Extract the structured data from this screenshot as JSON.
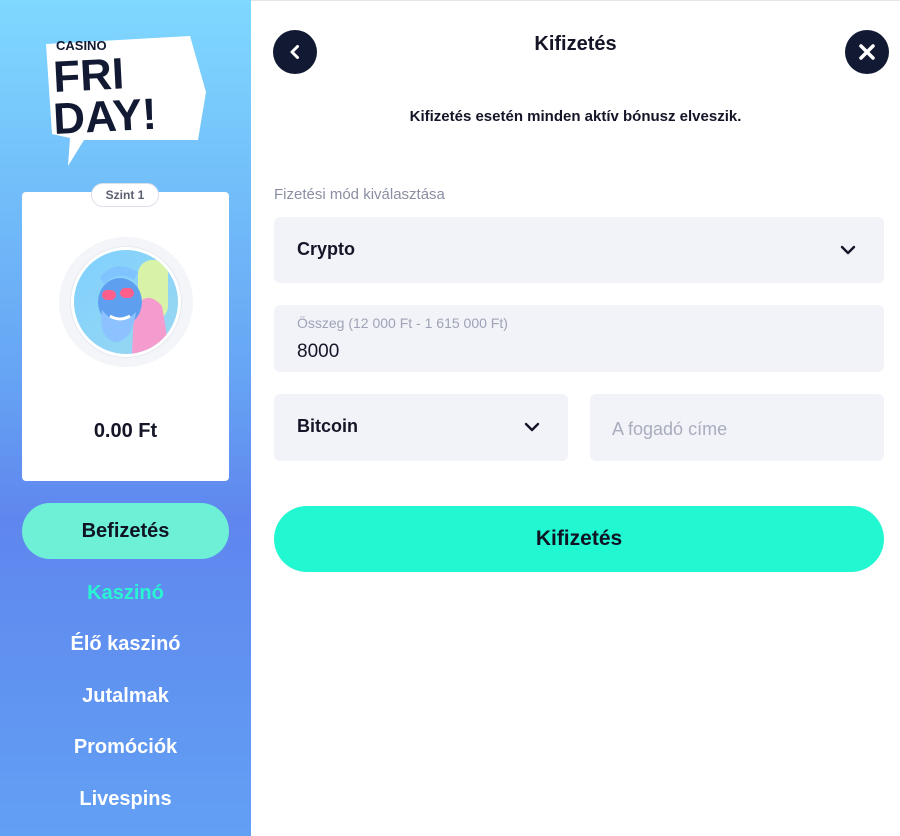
{
  "brand": {
    "logo_small": "CASINO",
    "logo_line1": "FRI",
    "logo_line2": "DAY!"
  },
  "profile": {
    "level": "Szint 1",
    "balance": "0.00 Ft"
  },
  "sidebar": {
    "deposit_label": "Befizetés",
    "nav": [
      {
        "label": "Kaszinó",
        "active": true
      },
      {
        "label": "Élő kaszinó",
        "active": false
      },
      {
        "label": "Jutalmak",
        "active": false
      },
      {
        "label": "Promóciók",
        "active": false
      },
      {
        "label": "Livespins",
        "active": false
      }
    ]
  },
  "header": {
    "title": "Kifizetés",
    "back_icon": "chevron-left-icon",
    "close_icon": "close-icon"
  },
  "form": {
    "warning": "Kifizetés esetén minden aktív bónusz elveszik.",
    "method_label": "Fizetési mód kiválasztása",
    "method_value": "Crypto",
    "amount_label": "Összeg (12 000 Ft - 1 615 000 Ft)",
    "amount_value": "8000",
    "currency_value": "Bitcoin",
    "address_placeholder": "A fogadó címe",
    "submit_label": "Kifizetés"
  },
  "colors": {
    "accent": "#21f7d0",
    "active_nav": "#29f5d2",
    "dark": "#121a33"
  }
}
